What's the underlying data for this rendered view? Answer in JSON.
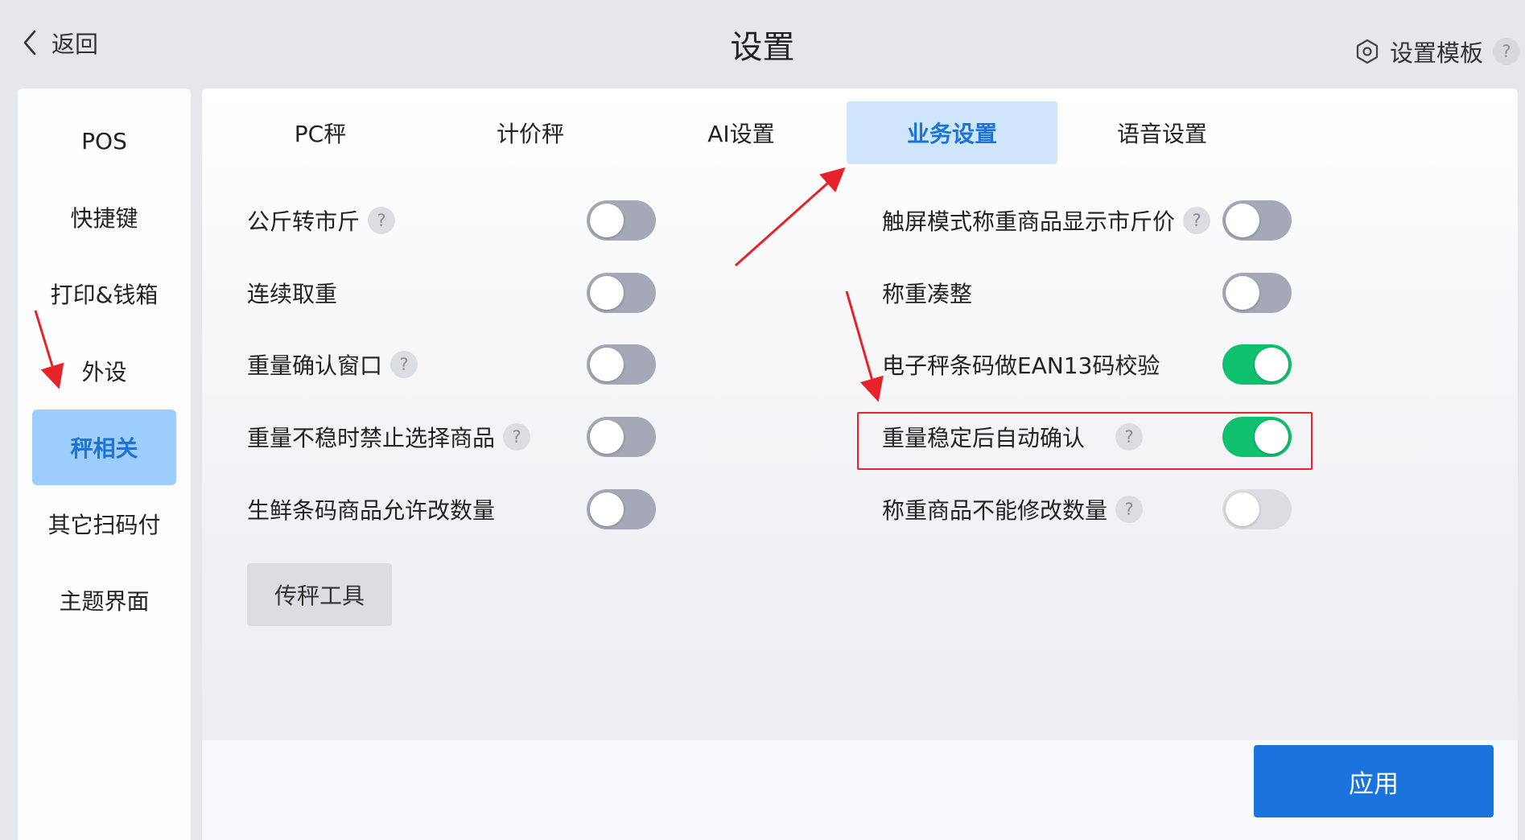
{
  "header": {
    "back_label": "返回",
    "title": "设置",
    "template_label": "设置模板",
    "help_mark": "?"
  },
  "sidebar": {
    "items": [
      {
        "label": "POS",
        "active": false
      },
      {
        "label": "快捷键",
        "active": false
      },
      {
        "label": "打印&钱箱",
        "active": false
      },
      {
        "label": "外设",
        "active": false
      },
      {
        "label": "秤相关",
        "active": true
      },
      {
        "label": "其它扫码付",
        "active": false
      },
      {
        "label": "主题界面",
        "active": false
      }
    ]
  },
  "tabs": [
    {
      "label": "PC秤",
      "active": false
    },
    {
      "label": "计价秤",
      "active": false
    },
    {
      "label": "AI设置",
      "active": false
    },
    {
      "label": "业务设置",
      "active": true
    },
    {
      "label": "语音设置",
      "active": false
    }
  ],
  "settings_left": [
    {
      "label": "公斤转市斤",
      "help": true,
      "state": "off"
    },
    {
      "label": "连续取重",
      "help": false,
      "state": "off"
    },
    {
      "label": "重量确认窗口",
      "help": true,
      "state": "off"
    },
    {
      "label": "重量不稳时禁止选择商品",
      "help": true,
      "state": "off"
    },
    {
      "label": "生鲜条码商品允许改数量",
      "help": false,
      "state": "off"
    }
  ],
  "settings_right": [
    {
      "label": "触屏模式称重商品显示市斤价",
      "help": true,
      "state": "off"
    },
    {
      "label": "称重凑整",
      "help": false,
      "state": "off"
    },
    {
      "label": "电子秤条码做EAN13码校验",
      "help": false,
      "state": "on"
    },
    {
      "label": "重量稳定后自动确认",
      "help": true,
      "state": "on"
    },
    {
      "label": "称重商品不能修改数量",
      "help": true,
      "state": "disabled"
    }
  ],
  "tool_button": "传秤工具",
  "apply_button": "应用",
  "colors": {
    "accent": "#1b74dd",
    "toggle_on": "#0fc06e",
    "toggle_off": "#a5a8b7",
    "annotation": "#e8222a"
  }
}
